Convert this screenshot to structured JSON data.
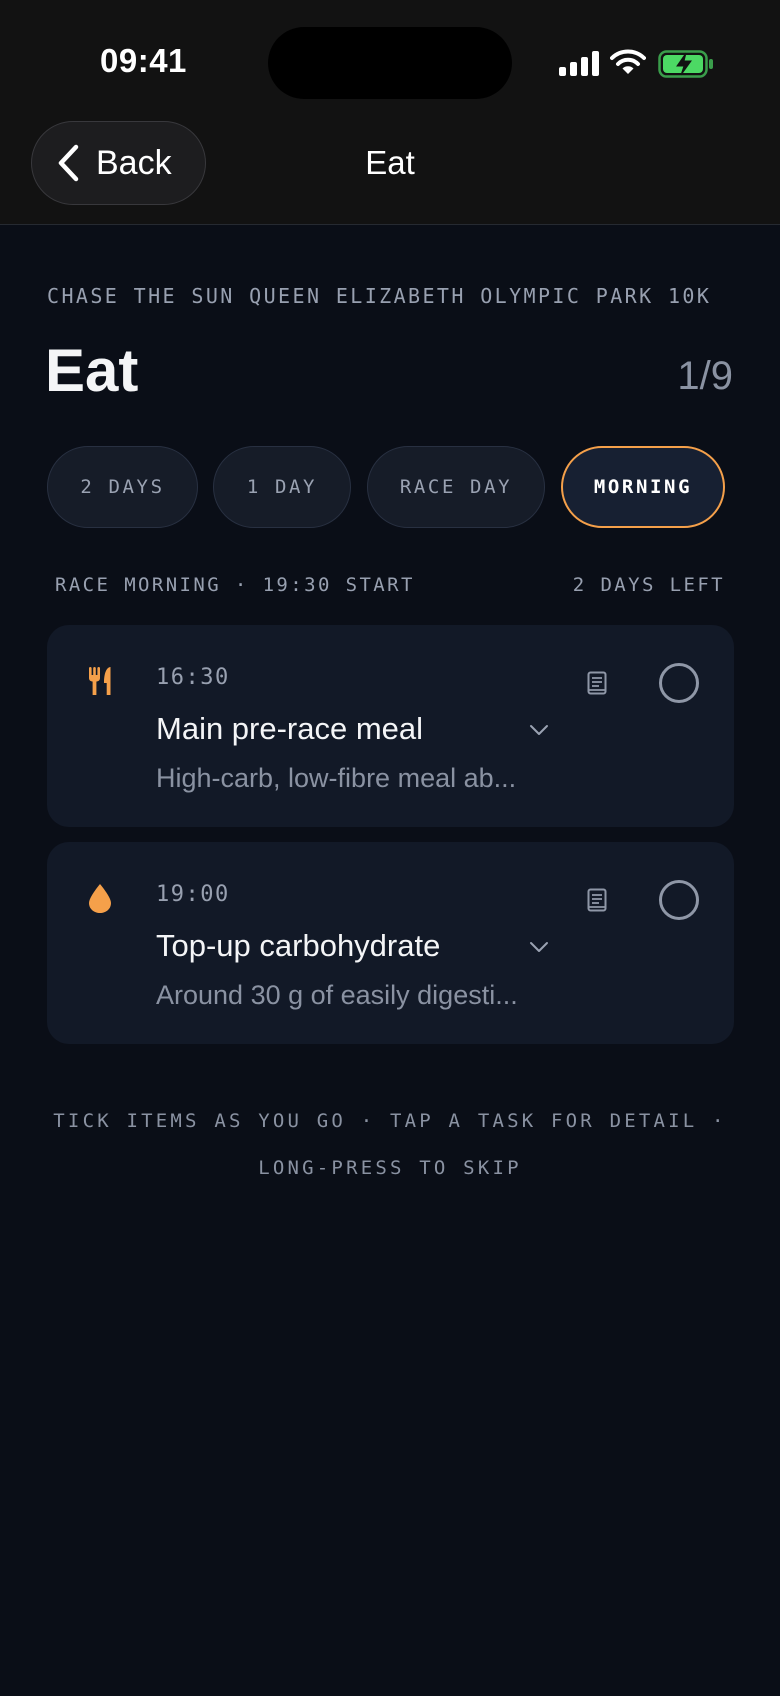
{
  "status_bar": {
    "time": "09:41"
  },
  "nav": {
    "back_label": "Back",
    "title": "Eat"
  },
  "event": {
    "name": "CHASE THE SUN QUEEN ELIZABETH OLYMPIC PARK 10K"
  },
  "header": {
    "title": "Eat",
    "counter": "1/9"
  },
  "tabs": [
    {
      "label": "2 DAYS",
      "active": false
    },
    {
      "label": "1 DAY",
      "active": false
    },
    {
      "label": "RACE DAY",
      "active": false
    },
    {
      "label": "MORNING",
      "active": true
    }
  ],
  "section": {
    "label": "RACE MORNING · 19:30 START",
    "countdown": "2 DAYS LEFT"
  },
  "tasks": [
    {
      "icon": "cutlery-icon",
      "time": "16:30",
      "title": "Main pre-race meal",
      "description": "High-carb, low-fibre meal ab...",
      "checked": false
    },
    {
      "icon": "droplet-icon",
      "time": "19:00",
      "title": "Top-up carbohydrate",
      "description": "Around 30 g of easily digesti...",
      "checked": false
    }
  ],
  "footer": {
    "line1": "TICK ITEMS AS YOU GO · TAP A TASK FOR DETAIL ·",
    "line2": "LONG-PRESS TO SKIP"
  },
  "colors": {
    "accent": "#f5a04a",
    "background": "#0a0e17",
    "card": "#121927",
    "battery": "#4cd964"
  }
}
